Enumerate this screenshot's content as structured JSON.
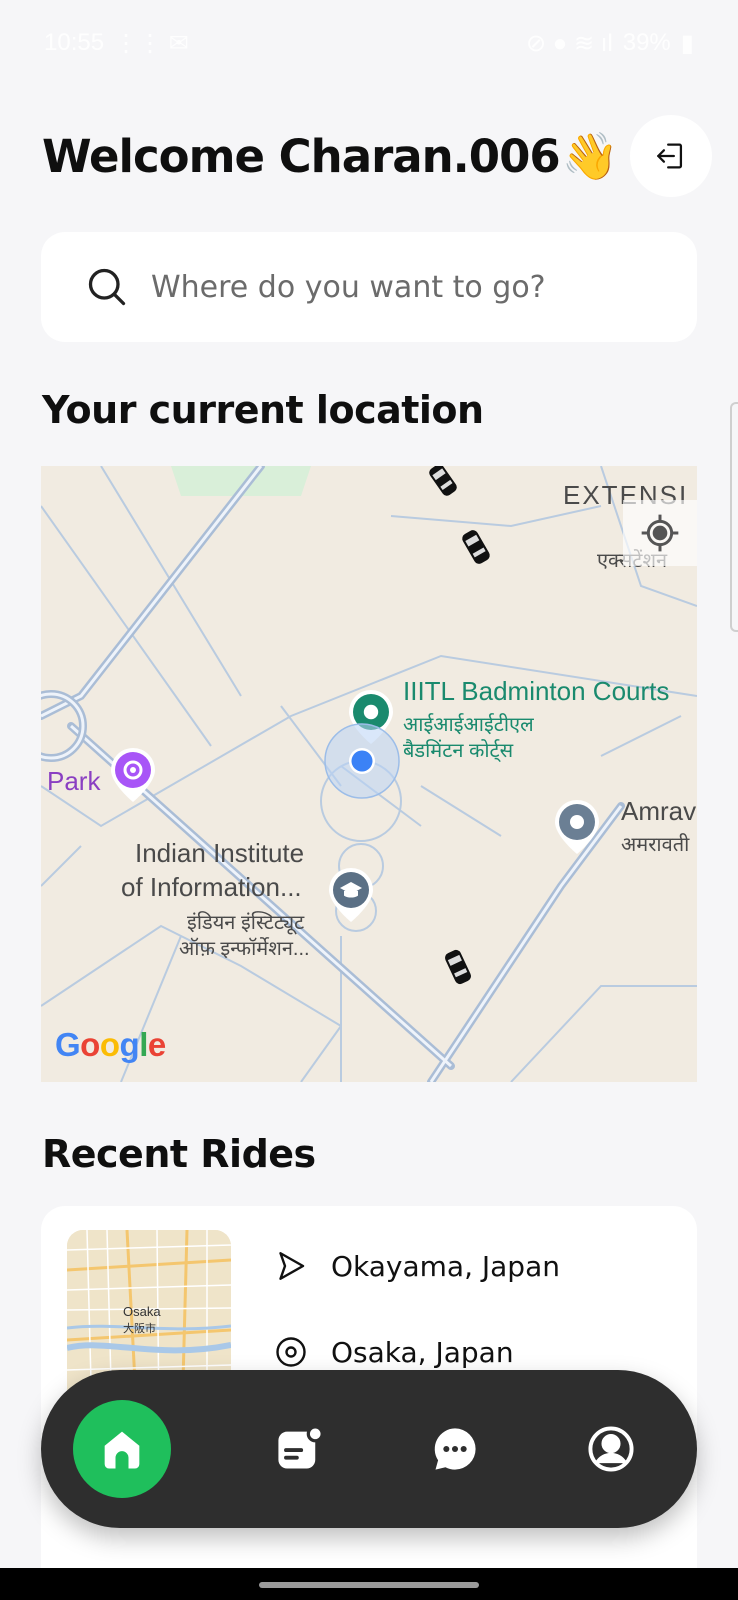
{
  "status_bar": {
    "time": "10:55",
    "battery": "39%"
  },
  "header": {
    "welcome_text": "Welcome Charan.006",
    "wave_emoji": "👋"
  },
  "search": {
    "placeholder": "Where do you want to go?"
  },
  "location_section": {
    "title": "Your current location"
  },
  "map": {
    "labels": {
      "extension": "EXTENSI",
      "extension_hi": "एक्सटेंशन",
      "courts_en": "IIITL Badminton Courts",
      "courts_hi_1": "आईआईआईटीएल",
      "courts_hi_2": "बैडमिंटन कोर्ट्स",
      "park": "Park",
      "institute_en_1": "Indian Institute",
      "institute_en_2": "of Information...",
      "institute_hi_1": "इंडियन इंस्टिट्यूट",
      "institute_hi_2": "ऑफ़ इन्फॉर्मेशन...",
      "amrav": "Amrav",
      "amrav_hi": "अमरावती"
    },
    "google_logo": "Google"
  },
  "recent_rides": {
    "title": "Recent Rides",
    "rides": [
      {
        "from": "Okayama, Japan",
        "to": "Osaka, Japan",
        "thumb_labels": {
          "osaka": "Osaka",
          "osaka_jp": "大阪市"
        }
      }
    ]
  },
  "nav": {
    "items": [
      "home",
      "rides",
      "chat",
      "profile"
    ],
    "active": "home"
  },
  "colors": {
    "accent": "#1fbf5c",
    "nav_bg": "#2e2e2e",
    "map_bg": "#f1ebe1",
    "poi_green": "#1a8a6e",
    "poi_purple": "#8a3fc2",
    "user_dot": "#3b82f6"
  }
}
